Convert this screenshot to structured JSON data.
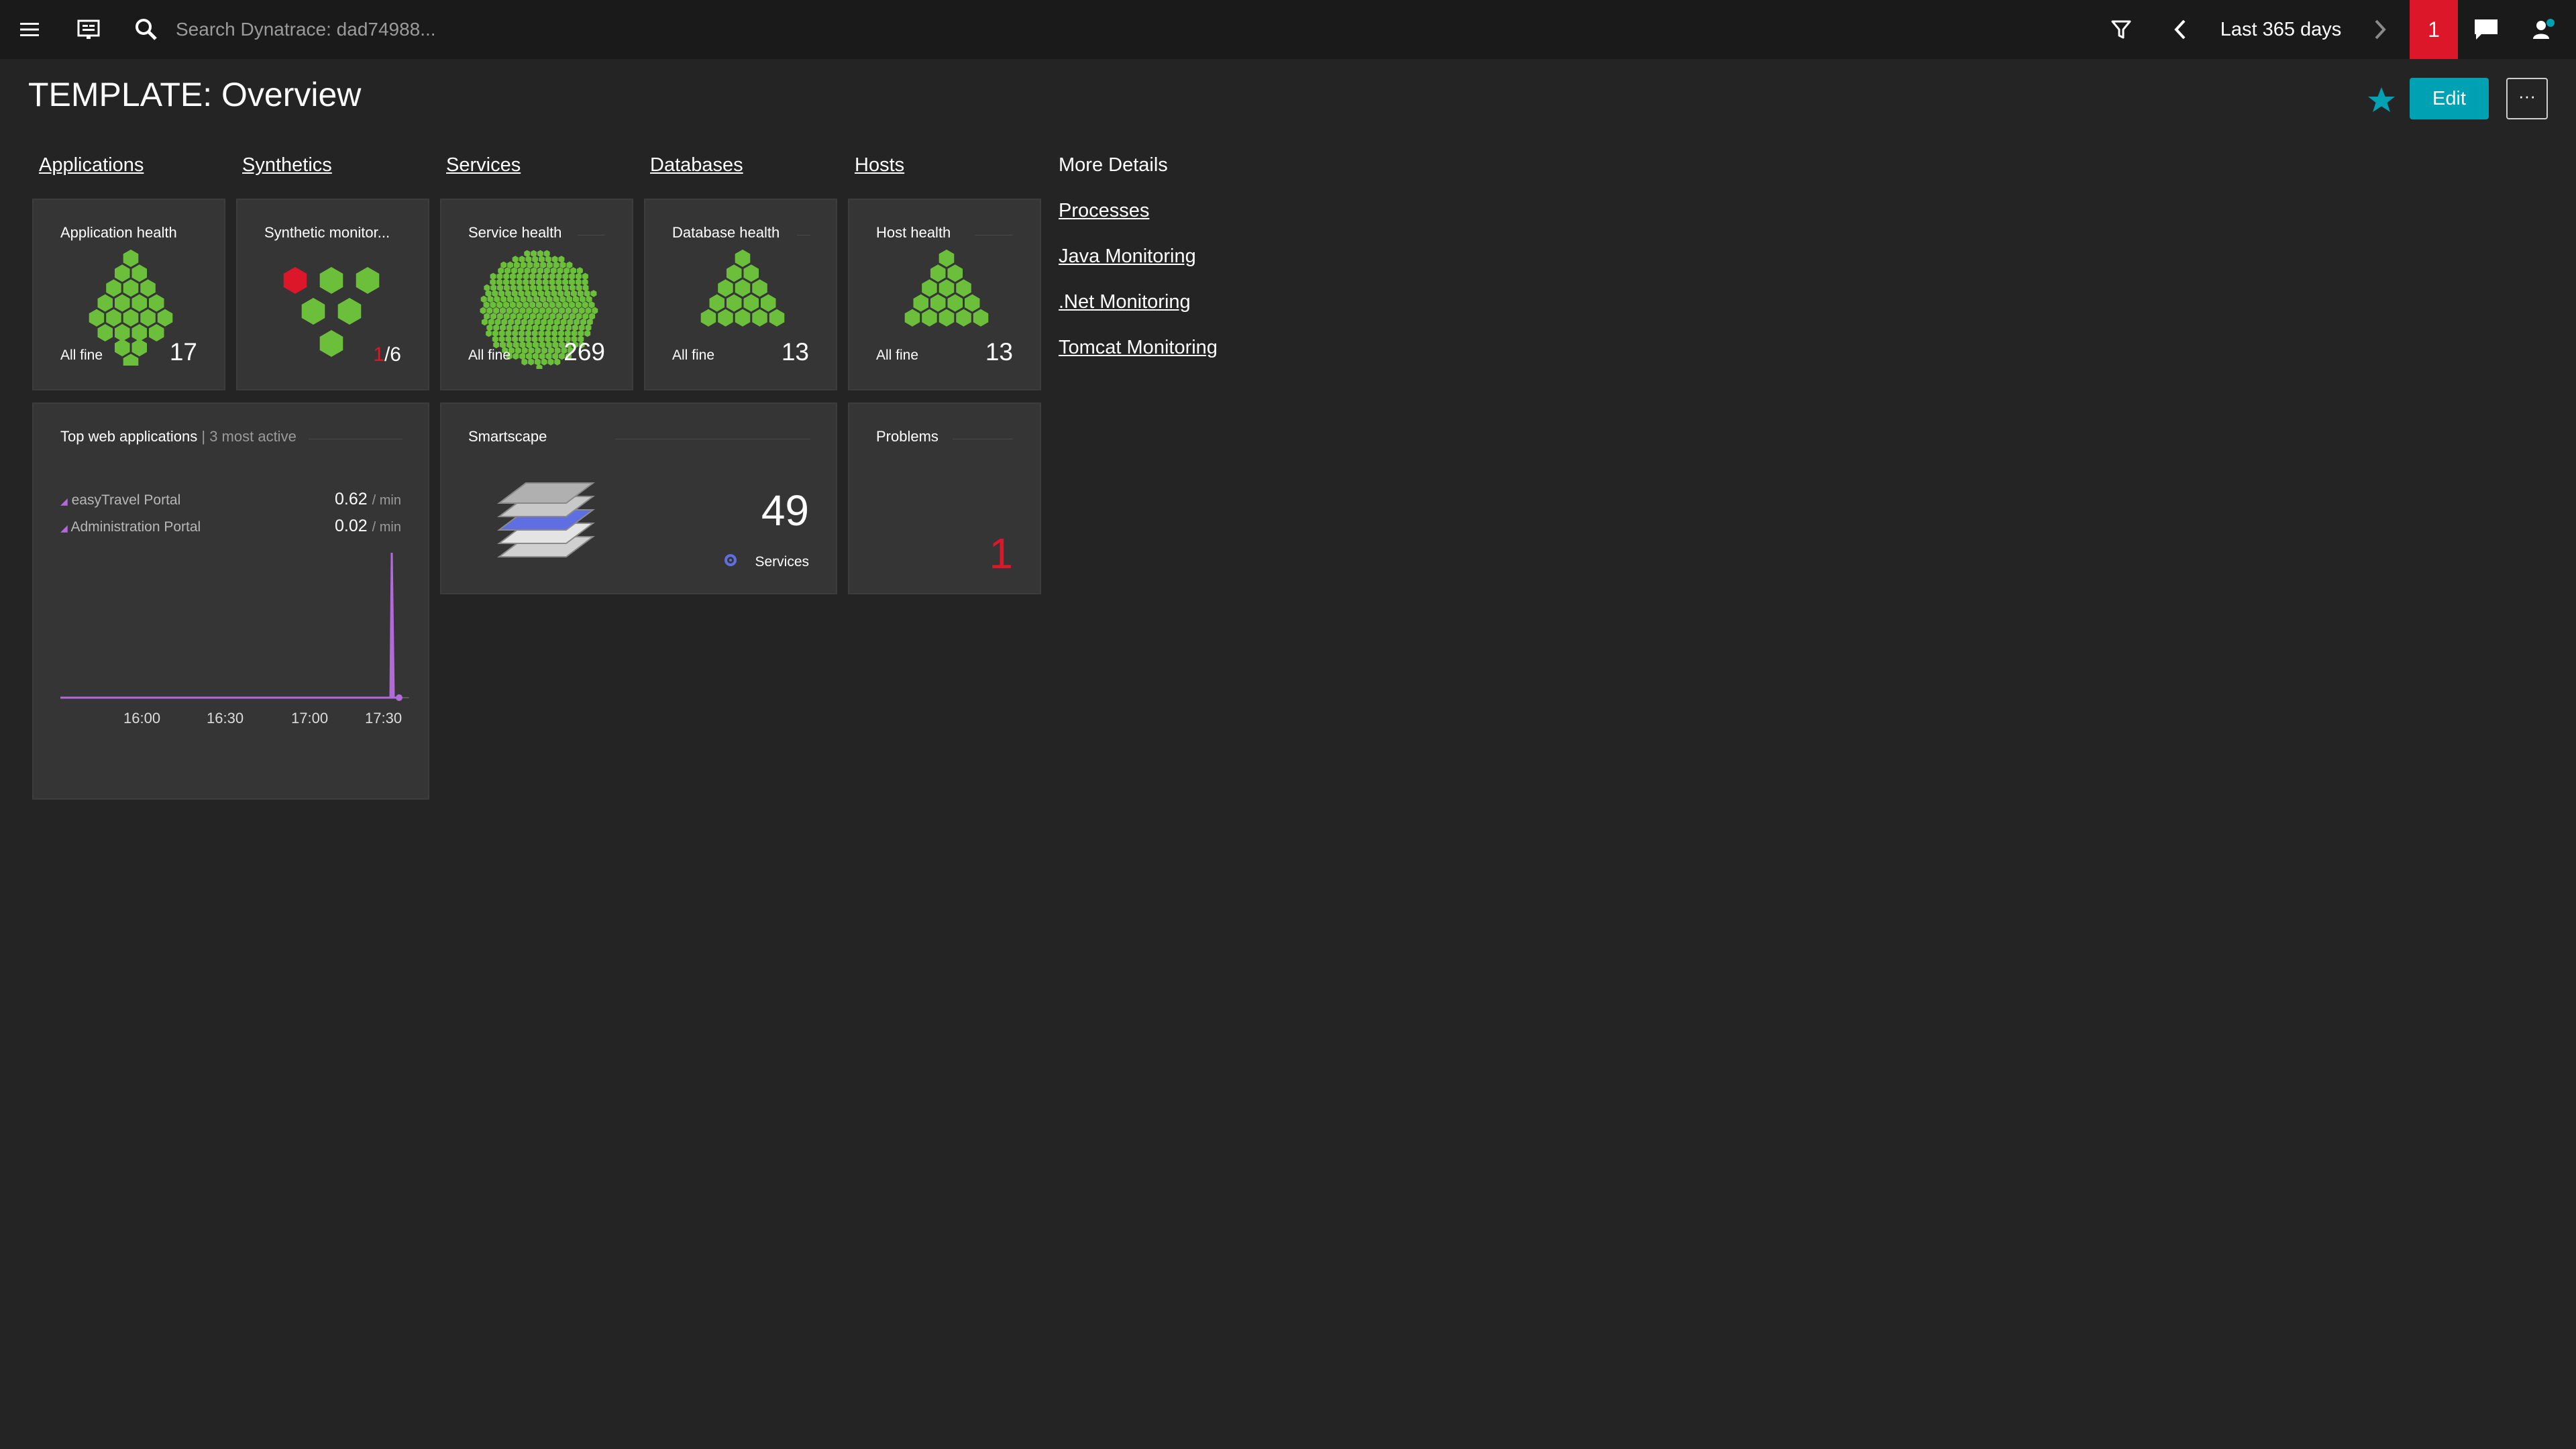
{
  "topbar": {
    "search_placeholder": "Search Dynatrace: dad74988...",
    "timeframe": "Last 365 days",
    "problem_count": "1",
    "icons": [
      "menu-icon",
      "dashboard-icon",
      "search-icon",
      "filter-icon",
      "chevron-left-icon",
      "chevron-right-icon",
      "chat-icon",
      "user-icon"
    ]
  },
  "page": {
    "title": "TEMPLATE: Overview",
    "edit_label": "Edit",
    "more_label": "···"
  },
  "nav": {
    "applications": "Applications",
    "synthetics": "Synthetics",
    "services": "Services",
    "databases": "Databases",
    "hosts": "Hosts"
  },
  "more_details": {
    "heading": "More Details",
    "links": [
      "Processes",
      "Java Monitoring",
      ".Net Monitoring",
      "Tomcat Monitoring"
    ]
  },
  "tiles": {
    "application_health": {
      "title": "Application health",
      "status": "All fine",
      "count": "17"
    },
    "synthetic": {
      "title": "Synthetic monitor...",
      "failed": "1",
      "total": "/6"
    },
    "service_health": {
      "title": "Service health",
      "status": "All fine",
      "count": "269"
    },
    "database_health": {
      "title": "Database health",
      "status": "All fine",
      "count": "13"
    },
    "host_health": {
      "title": "Host health",
      "status": "All fine",
      "count": "13"
    },
    "top_web_apps": {
      "title": "Top web applications",
      "subtitle": "| 3 most active",
      "apps": [
        {
          "name": "easyTravel Portal",
          "value": "0.62",
          "unit": "/ min"
        },
        {
          "name": "Administration Portal",
          "value": "0.02",
          "unit": "/ min"
        }
      ],
      "x_ticks": [
        "16:00",
        "16:30",
        "17:00",
        "17:30"
      ]
    },
    "smartscape": {
      "title": "Smartscape",
      "count": "49",
      "label": "Services"
    },
    "problems": {
      "title": "Problems",
      "count": "1"
    }
  },
  "colors": {
    "healthy": "#6bbf3a",
    "problem": "#dc172a",
    "accent": "#00a1b2",
    "chart_line": "#b36ad9"
  }
}
